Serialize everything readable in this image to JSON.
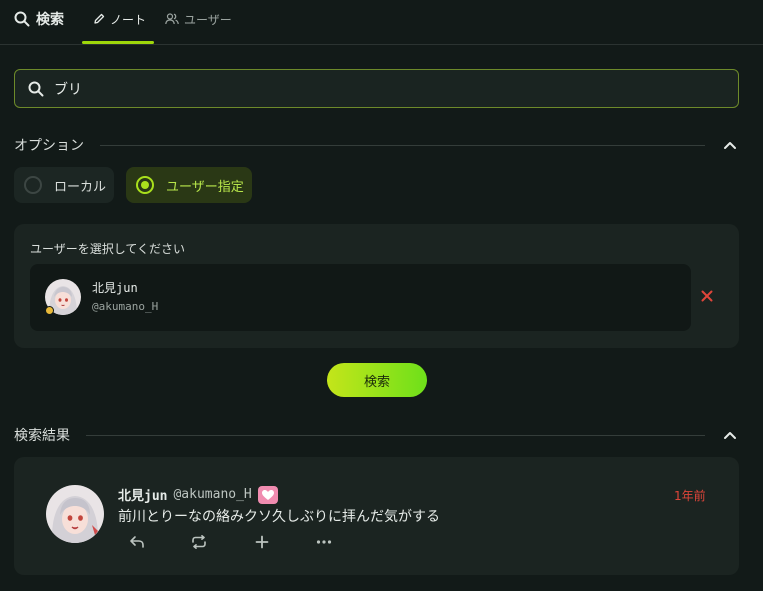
{
  "header": {
    "title": "検索",
    "tabs": [
      {
        "label": "ノート",
        "active": true
      },
      {
        "label": "ユーザー",
        "active": false
      }
    ]
  },
  "search": {
    "value": "ブリ"
  },
  "options": {
    "label": "オプション",
    "choices": [
      {
        "label": "ローカル",
        "selected": false
      },
      {
        "label": "ユーザー指定",
        "selected": true
      }
    ]
  },
  "user_select": {
    "label": "ユーザーを選択してください",
    "user": {
      "name": "北見jun",
      "handle": "@akumano_H",
      "status": "away"
    }
  },
  "search_button": {
    "label": "検索"
  },
  "results": {
    "label": "検索結果",
    "notes": [
      {
        "name": "北見jun",
        "handle": "@akumano_H",
        "time": "1年前",
        "text": "前川とりーなの絡みクソ久しぶりに拝んだ気がする",
        "actions": [
          "reply-icon",
          "renote-icon",
          "plus-icon",
          "more-icon"
        ]
      }
    ]
  },
  "colors": {
    "accent": "#9ed60a",
    "background": "#121a18",
    "panel": "#1b2421",
    "danger": "#e0453a"
  }
}
